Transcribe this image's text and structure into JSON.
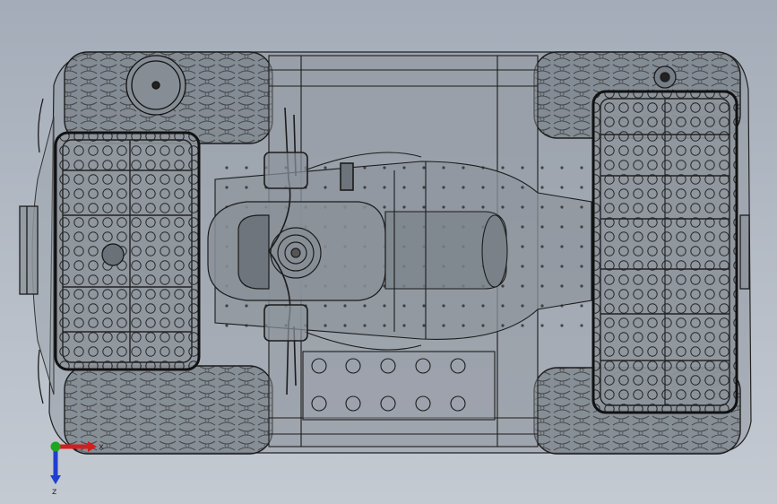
{
  "viewport": {
    "background_top": "#a3acb8",
    "background_bottom": "#c4cad2"
  },
  "model": {
    "line_color": "#1c1c1c",
    "body_fill": "#8d949c"
  },
  "triad": {
    "x_label": "x",
    "z_label": "z",
    "x_color": "#d11f1f",
    "y_color": "#1fa51f",
    "z_color": "#1f3fd1"
  }
}
